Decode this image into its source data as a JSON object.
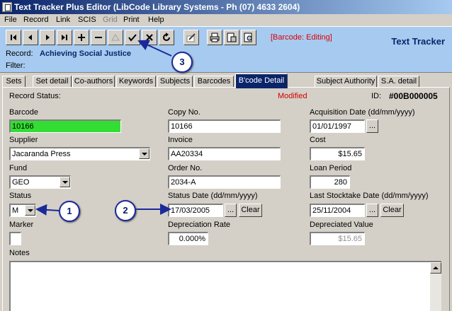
{
  "window": {
    "title": "Text Tracker Plus Editor  (LibCode Library Systems - Ph (07) 4633 2604)"
  },
  "menu": [
    "File",
    "Record",
    "Link",
    "SCIS",
    "Grid",
    "Print",
    "Help"
  ],
  "toolbar": {
    "buttons": [
      "first-record",
      "previous-record",
      "next-record",
      "last-record",
      "add-record",
      "delete-record",
      "edit-record",
      "save-record",
      "cancel-edit",
      "refresh",
      "edit-pencil",
      "print",
      "print-preview",
      "report"
    ],
    "status": "[Barcode: Editing]",
    "brand": "Text Tracker",
    "record_label": "Record:",
    "record_value": "Achieving Social Justice",
    "filter_label": "Filter:"
  },
  "tabs": [
    "Sets",
    "Set detail",
    "Co-authors",
    "Keywords",
    "Subjects",
    "Barcodes",
    "B'code Detail",
    "Subject Authority",
    "S.A. detail"
  ],
  "active_tab": "B'code Detail",
  "form": {
    "record_status_label": "Record Status:",
    "record_status_value": "Modified",
    "id_label": "ID:",
    "id_value": "#00B000005",
    "barcode_label": "Barcode",
    "barcode_value": "10166",
    "copy_no_label": "Copy No.",
    "copy_no_value": "10166",
    "acq_date_label": "Acquisition Date (dd/mm/yyyy)",
    "acq_date_value": "01/01/1997",
    "supplier_label": "Supplier",
    "supplier_value": "Jacaranda Press",
    "invoice_label": "Invoice",
    "invoice_value": "AA20334",
    "cost_label": "Cost",
    "cost_value": "$15.65",
    "fund_label": "Fund",
    "fund_value": "GEO",
    "order_no_label": "Order No.",
    "order_no_value": "2034-A",
    "loan_period_label": "Loan Period",
    "loan_period_value": "280",
    "status_label": "Status",
    "status_value": "M",
    "status_date_label": "Status Date (dd/mm/yyyy)",
    "status_date_value": "17/03/2005",
    "stocktake_label": "Last Stocktake Date (dd/mm/yyyy)",
    "stocktake_value": "25/11/2004",
    "marker_label": "Marker",
    "depreciation_rate_label": "Depreciation Rate",
    "depreciation_rate_value": "0.000%",
    "depreciated_value_label": "Depreciated Value",
    "depreciated_value_value": "$15.65",
    "notes_label": "Notes",
    "ellipsis": "...",
    "clear": "Clear"
  },
  "callouts": [
    "1",
    "2",
    "3"
  ]
}
